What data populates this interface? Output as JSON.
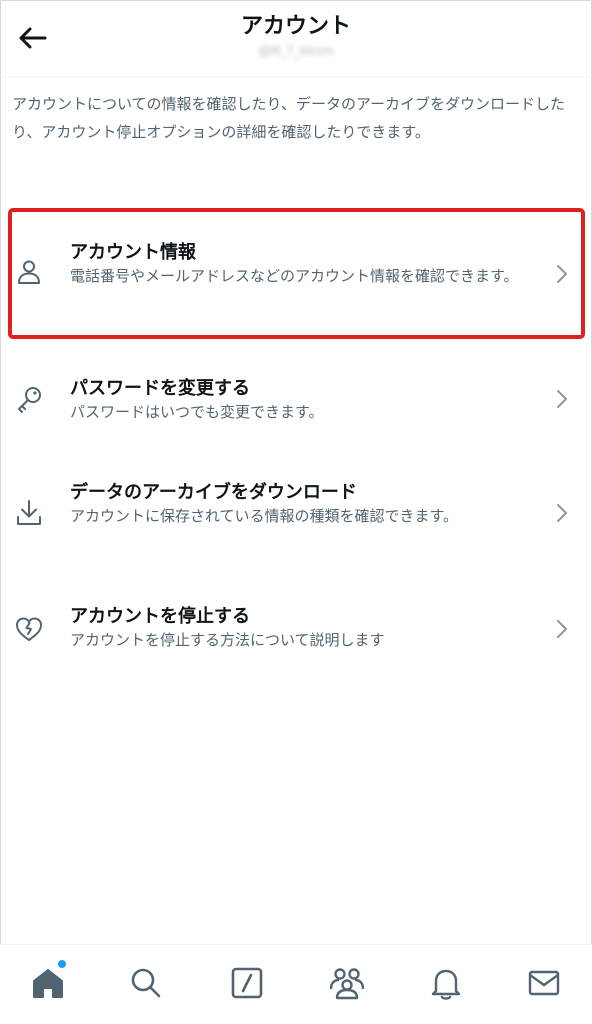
{
  "header": {
    "title": "アカウント",
    "handle": "@M_T_bknm",
    "back_icon": "arrow-left-icon"
  },
  "description": "アカウントについての情報を確認したり、データのアーカイブをダウンロードしたり、アカウント停止オプションの詳細を確認したりできます。",
  "menu": {
    "items": [
      {
        "title": "アカウント情報",
        "subtitle": "電話番号やメールアドレスなどのアカウント情報を確認できます。",
        "icon": "person-icon",
        "highlighted": true
      },
      {
        "title": "パスワードを変更する",
        "subtitle": "パスワードはいつでも変更できます。",
        "icon": "key-icon",
        "highlighted": false
      },
      {
        "title": "データのアーカイブをダウンロード",
        "subtitle": "アカウントに保存されている情報の種類を確認できます。",
        "icon": "download-icon",
        "highlighted": false
      },
      {
        "title": "アカウントを停止する",
        "subtitle": "アカウントを停止する方法について説明します",
        "icon": "broken-heart-icon",
        "highlighted": false
      }
    ]
  },
  "tabbar": {
    "tabs": [
      {
        "name": "home",
        "icon": "home-icon",
        "active": true,
        "has_notification": true
      },
      {
        "name": "search",
        "icon": "search-icon",
        "active": false
      },
      {
        "name": "compose",
        "icon": "compose-icon",
        "active": false
      },
      {
        "name": "communities",
        "icon": "communities-icon",
        "active": false
      },
      {
        "name": "notifications",
        "icon": "bell-icon",
        "active": false
      },
      {
        "name": "messages",
        "icon": "mail-icon",
        "active": false
      }
    ]
  },
  "colors": {
    "text_primary": "#0f1419",
    "text_secondary": "#536471",
    "icon_gray": "#536471",
    "chevron_gray": "#8b98a5",
    "highlight_red": "#e0201f",
    "accent_blue": "#1d9bf0"
  }
}
